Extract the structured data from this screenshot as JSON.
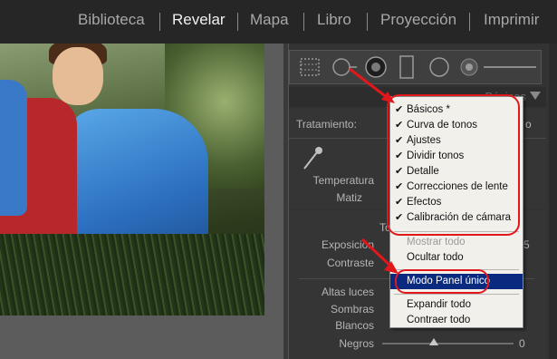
{
  "modules": [
    "Biblioteca",
    "Revelar",
    "Mapa",
    "Libro",
    "Proyección",
    "Imprimir"
  ],
  "active_module": "Revelar",
  "panel": {
    "header_title": "Básicos",
    "tratamiento_label": "Tratamiento:",
    "tratamiento_value": "o",
    "temperatura_label": "Temperatura",
    "matiz_label": "Matiz",
    "tono_label": "To",
    "exposicion_label": "Exposición",
    "exposicion_value": "5",
    "contraste_label": "Contraste",
    "altas_luces_label": "Altas luces",
    "sombras_label": "Sombras",
    "blancos_label": "Blancos",
    "negros_label": "Negros",
    "negros_value": "0"
  },
  "menu": {
    "checked_items": [
      "Básicos *",
      "Curva de tonos",
      "Ajustes",
      "Dividir tonos",
      "Detalle",
      "Correcciones de lente",
      "Efectos",
      "Calibración de cámara"
    ],
    "check_glyph": "✔",
    "mostrar_todo": "Mostrar todo",
    "ocultar_todo": "Ocultar todo",
    "modo_panel": "Modo Panel único",
    "expandir_todo": "Expandir todo",
    "contraer_todo": "Contraer todo"
  },
  "colors": {
    "highlight": "#0a2a80",
    "annotation_red": "#e0181c"
  }
}
